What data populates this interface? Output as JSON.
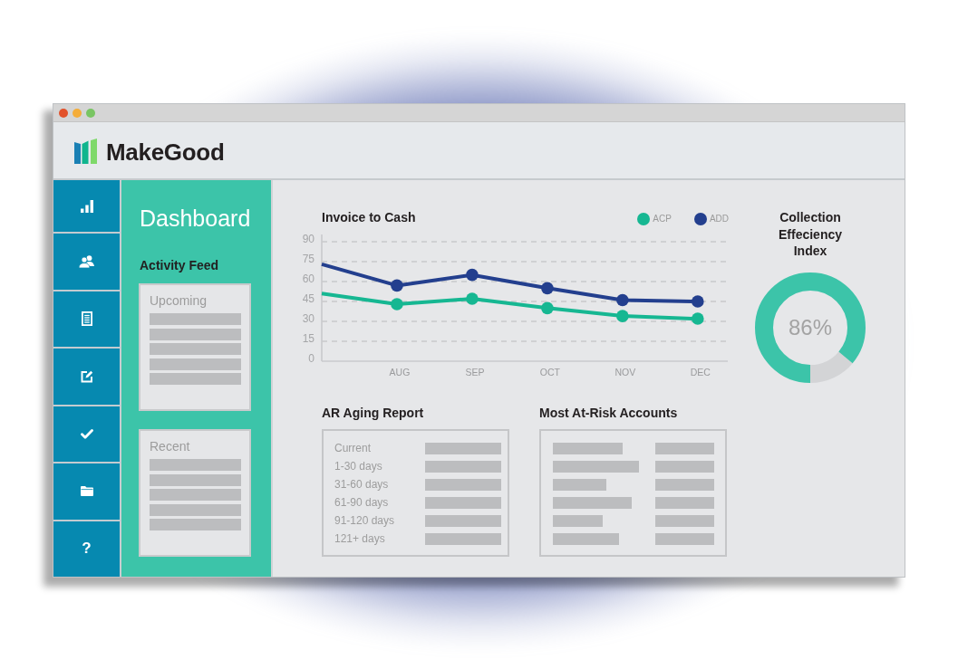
{
  "header": {
    "brand": "MakeGood"
  },
  "sidebar": {
    "help_label": "?"
  },
  "panel": {
    "title": "Dashboard",
    "section": "Activity Feed",
    "cards": [
      "Upcoming",
      "Recent"
    ]
  },
  "invoice_chart": {
    "chart_data": {
      "type": "line",
      "title": "Invoice to Cash",
      "categories": [
        null,
        "AUG",
        "SEP",
        "OCT",
        "NOV",
        "DEC"
      ],
      "ylim": [
        0,
        90
      ],
      "yticks": [
        0,
        15,
        30,
        45,
        60,
        75,
        90
      ],
      "grid": true,
      "legend": "upper right",
      "series": [
        {
          "name": "ACP",
          "color": "#16b792",
          "marker": "circle",
          "values": [
            51,
            43,
            47,
            40,
            34,
            32
          ]
        },
        {
          "name": "ADD",
          "color": "#233f8e",
          "marker": "circle",
          "values": [
            73,
            57,
            65,
            55,
            46,
            45
          ]
        }
      ]
    }
  },
  "gauge": {
    "title": "Collection Effeciency Index",
    "reading": "86%",
    "level": 0.86
  },
  "ar_aging": {
    "title": "AR Aging Report",
    "rows": [
      "Current",
      "1-30 days",
      "31-60 days",
      "61-90 days",
      "91-120 days",
      "121+ days"
    ]
  },
  "at_risk": {
    "title": "Most At-Risk Accounts"
  }
}
